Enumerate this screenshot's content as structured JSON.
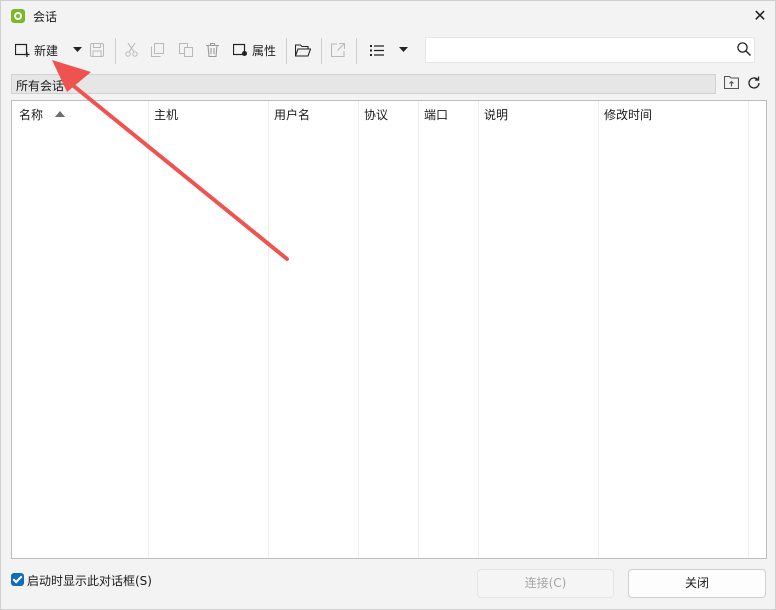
{
  "window": {
    "title": "会话"
  },
  "toolbar": {
    "new_label": "新建",
    "properties_label": "属性"
  },
  "search": {
    "placeholder": ""
  },
  "path": {
    "label": "所有会话"
  },
  "columns": [
    "名称",
    "主机",
    "用户名",
    "协议",
    "端口",
    "说明",
    "修改时间"
  ],
  "footer": {
    "show_on_startup_label": "启动时显示此对话框(S)",
    "show_on_startup_checked": true,
    "connect_label": "连接(C)",
    "close_label": "关闭"
  },
  "colors": {
    "accent": "#0f6cbd",
    "annotation_arrow": "#ef5350",
    "app_icon": "#7ab927"
  }
}
